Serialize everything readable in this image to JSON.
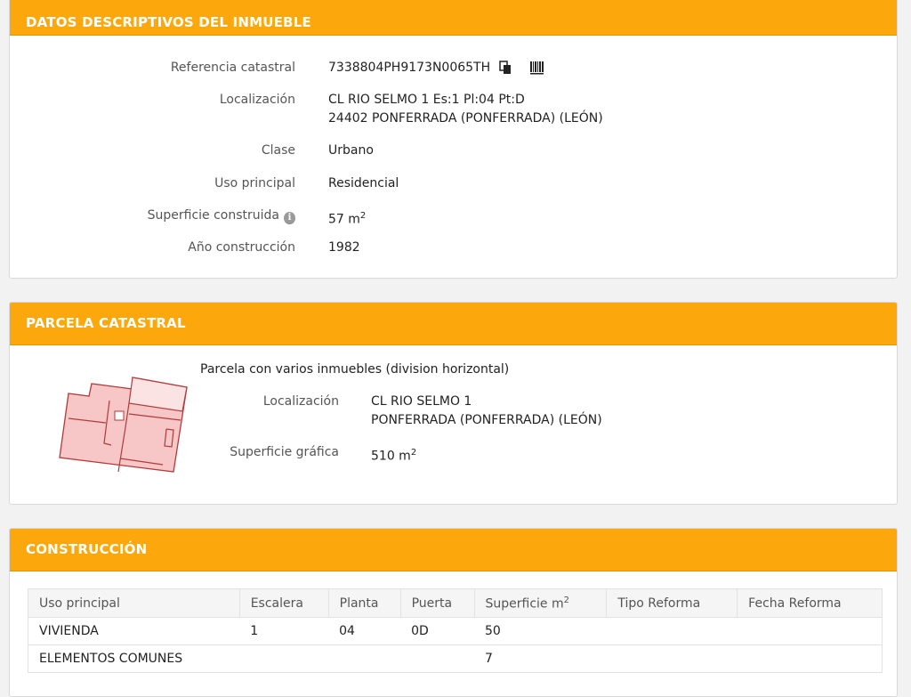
{
  "inmueble": {
    "header": "DATOS DESCRIPTIVOS DEL INMUEBLE",
    "referencia_label": "Referencia catastral",
    "referencia_value": "7338804PH9173N0065TH",
    "localizacion_label": "Localización",
    "localizacion_line1": "CL RIO SELMO 1 Es:1 Pl:04 Pt:D",
    "localizacion_line2": "24402 PONFERRADA (PONFERRADA) (LEÓN)",
    "clase_label": "Clase",
    "clase_value": "Urbano",
    "uso_label": "Uso principal",
    "uso_value": "Residencial",
    "superficie_label": "Superficie construida",
    "superficie_value": "57 m",
    "superficie_sup": "2",
    "anio_label": "Año construcción",
    "anio_value": "1982",
    "info_icon_glyph": "i"
  },
  "parcela": {
    "header": "PARCELA CATASTRAL",
    "descripcion": "Parcela con varios inmuebles (division horizontal)",
    "localizacion_label": "Localización",
    "localizacion_line1": "CL RIO SELMO 1",
    "localizacion_line2": "PONFERRADA (PONFERRADA) (LEÓN)",
    "superficie_label": "Superficie gráfica",
    "superficie_value": "510 m",
    "superficie_sup": "2"
  },
  "construccion": {
    "header": "CONSTRUCCIÓN",
    "columns": {
      "uso": "Uso principal",
      "escalera": "Escalera",
      "planta": "Planta",
      "puerta": "Puerta",
      "superficie": "Superficie m",
      "superficie_sup": "2",
      "tipo_reforma": "Tipo Reforma",
      "fecha_reforma": "Fecha Reforma"
    },
    "rows": [
      {
        "uso": "VIVIENDA",
        "escalera": "1",
        "planta": "04",
        "puerta": "0D",
        "superficie": "50",
        "tipo_reforma": "",
        "fecha_reforma": ""
      },
      {
        "uso": "ELEMENTOS COMUNES",
        "escalera": "",
        "planta": "",
        "puerta": "",
        "superficie": "7",
        "tipo_reforma": "",
        "fecha_reforma": ""
      }
    ]
  },
  "colors": {
    "accent": "#fca80c",
    "plot_fill": "#f7c6c6",
    "plot_stroke": "#b33a3a"
  }
}
